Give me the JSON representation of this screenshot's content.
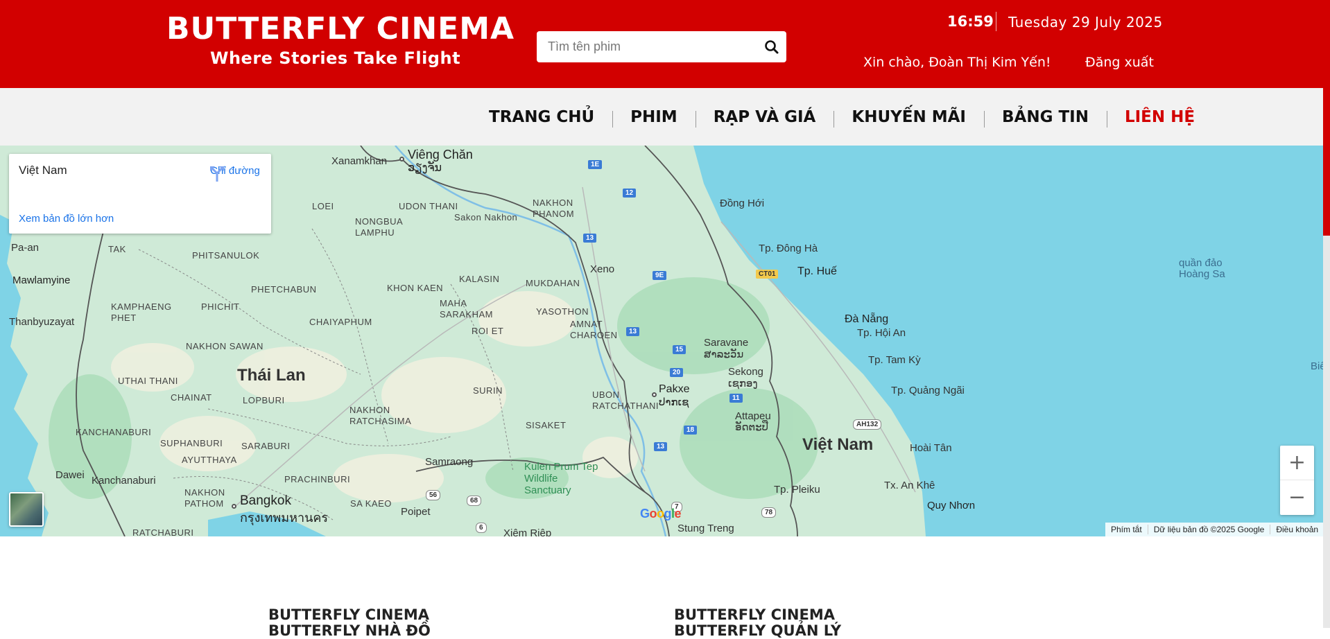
{
  "header": {
    "brand_title": "BUTTERFLY CINEMA",
    "brand_tagline": "Where Stories Take Flight",
    "search_placeholder": "Tìm tên phim",
    "time": "16:59",
    "date": "Tuesday 29 July 2025",
    "greeting": "Xin chào, Đoàn Thị Kim Yến!",
    "logout_label": "Đăng xuất"
  },
  "nav": {
    "items": [
      {
        "label": "TRANG CHỦ"
      },
      {
        "label": "PHIM"
      },
      {
        "label": "RẠP VÀ GIÁ"
      },
      {
        "label": "KHUYẾN MÃI"
      },
      {
        "label": "BẢNG TIN"
      },
      {
        "label": "LIÊN HỆ",
        "active": true
      }
    ],
    "active_color": "#d20000"
  },
  "map": {
    "info_card": {
      "title": "Việt Nam",
      "directions_label": "Chỉ đường",
      "larger_map_label": "Xem bản đồ lớn hơn"
    },
    "labels": {
      "thailand": "Thái Lan",
      "vietnam": "Việt Nam",
      "bangkok": "Bangkok",
      "bangkok_th": "กรุงเทพมหานคร",
      "vientiane": "Viêng Chăn",
      "vientiane_lo": "ວຽງຈັນ",
      "pakxe": "Pakxe",
      "pakxe_lo": "ປາກເຊ",
      "saravane": "Saravane",
      "saravane_lo": "ສາລະວັນ",
      "sekong": "Sekong",
      "sekong_lo": "ເຊກອງ",
      "attapeu": "Attapeu",
      "attapeu_lo": "ອັດຕະປື",
      "xeno": "Xeno",
      "dong_hoi": "Đồng Hới",
      "dong_ha": "Tp. Đông Hà",
      "hue": "Tp. Huế",
      "da_nang": "Đà Nẵng",
      "hoi_an": "Tp. Hội An",
      "tam_ky": "Tp. Tam Kỳ",
      "quang_ngai": "Tp. Quảng Ngãi",
      "hoai_tan": "Hoài Tân",
      "an_khe": "Tx. An Khê",
      "pleiku": "Tp. Pleiku",
      "quy_nhon": "Quy Nhơn",
      "stung_treng": "Stung Treng",
      "xiem_riep": "Xiêm Riệp",
      "samraong": "Samraong",
      "poipet": "Poipet",
      "kulen": "Kulen Prum Tep Wildlife Sanctuary",
      "paracel": "quần đảo Hoàng Sa",
      "bien": "Biể",
      "mawlamyine": "Mawlamyine",
      "thanbyuzayat": "Thanbyuzayat",
      "dawei": "Dawei",
      "kanchanaburi_city": "Kanchanaburi",
      "pa_an": "Pa-an",
      "xanamkhan": "Xanamkhan",
      "loei": "LOEI",
      "udon": "UDON THANI",
      "nongbua": "NONGBUA LAMPHU",
      "sakon": "Sakon Nakhon",
      "nakhon_phanom": "NAKHON PHANOM",
      "tak": "TAK",
      "phitsanulok": "PHITSANULOK",
      "phetchabun": "PHETCHABUN",
      "khon_kaen": "KHON KAEN",
      "kalasin": "KALASIN",
      "mukdahan": "MUKDAHAN",
      "kamphaeng": "KAMPHAENG PHET",
      "phichit": "PHICHIT",
      "maha": "MAHA SARAKHAM",
      "yasothon": "YASOTHON",
      "amnat": "AMNAT CHAROEN",
      "chaiyaphum": "CHAIYAPHUM",
      "roi_et": "ROI ET",
      "nakhon_sawan": "NAKHON SAWAN",
      "uthai": "UTHAI THANI",
      "chainat": "CHAINAT",
      "lopburi": "LOPBURI",
      "surin": "SURIN",
      "ubon": "UBON RATCHATHANI",
      "ratchasima": "NAKHON RATCHASIMA",
      "sisaket": "SISAKET",
      "kanchanaburi": "KANCHANABURI",
      "suphanburi": "SUPHANBURI",
      "saraburi": "SARABURI",
      "ayutthaya": "AYUTTHAYA",
      "prachinburi": "PRACHINBURI",
      "nakhon_pathom": "NAKHON PATHOM",
      "sa_kaeo": "SA KAEO",
      "ratchaburi": "RATCHABURI"
    },
    "shields": [
      "1E",
      "12",
      "13",
      "9E",
      "13",
      "15",
      "20",
      "11",
      "18",
      "13",
      "CT01",
      "AH132",
      "56",
      "68",
      "6",
      "78",
      "7"
    ],
    "google": "Google",
    "footer": {
      "shortcuts": "Phím tắt",
      "data": "Dữ liệu bản đồ ©2025 Google",
      "terms": "Điều khoản"
    },
    "zoom_in": "+",
    "zoom_out": "−"
  },
  "bottom": {
    "col1_title": "BUTTERFLY CINEMA",
    "col1_sub": "BUTTERFLY NHÀ ĐỒ",
    "col2_title": "BUTTERFLY CINEMA",
    "col2_sub": "BUTTERFLY QUẢN LÝ"
  }
}
